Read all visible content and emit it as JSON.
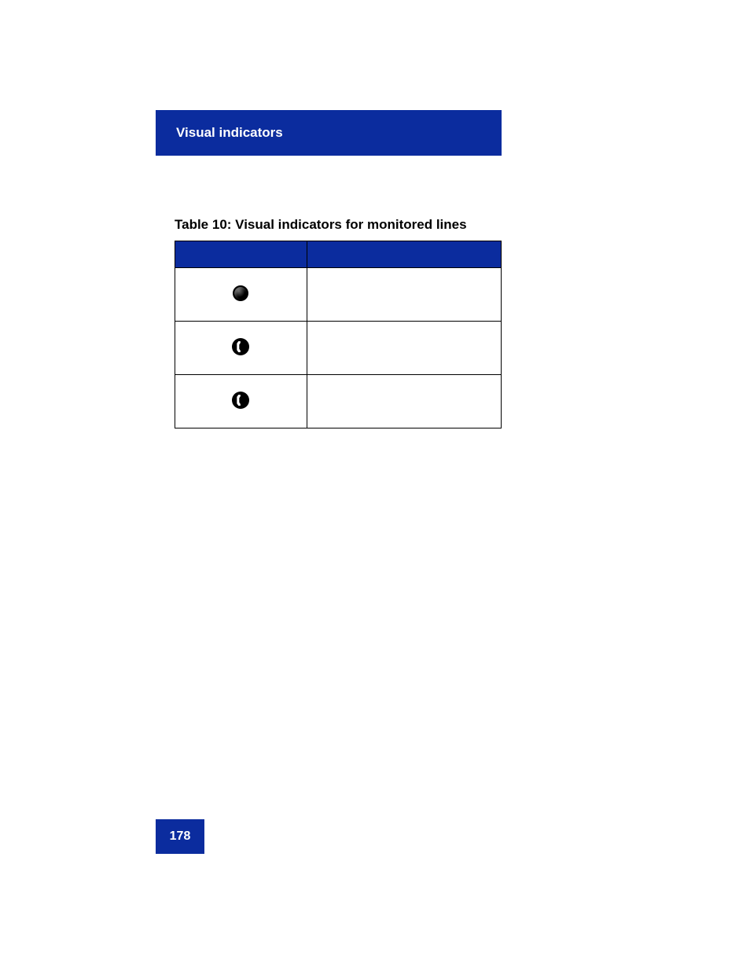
{
  "header": {
    "title": "Visual indicators"
  },
  "table": {
    "caption": "Table 10: Visual indicators for monitored lines",
    "headers": [
      "",
      ""
    ],
    "rows": [
      {
        "icon": "solid-circle",
        "desc": ""
      },
      {
        "icon": "phone-circle",
        "desc": ""
      },
      {
        "icon": "phone-circle",
        "desc": ""
      }
    ]
  },
  "page_number": "178"
}
